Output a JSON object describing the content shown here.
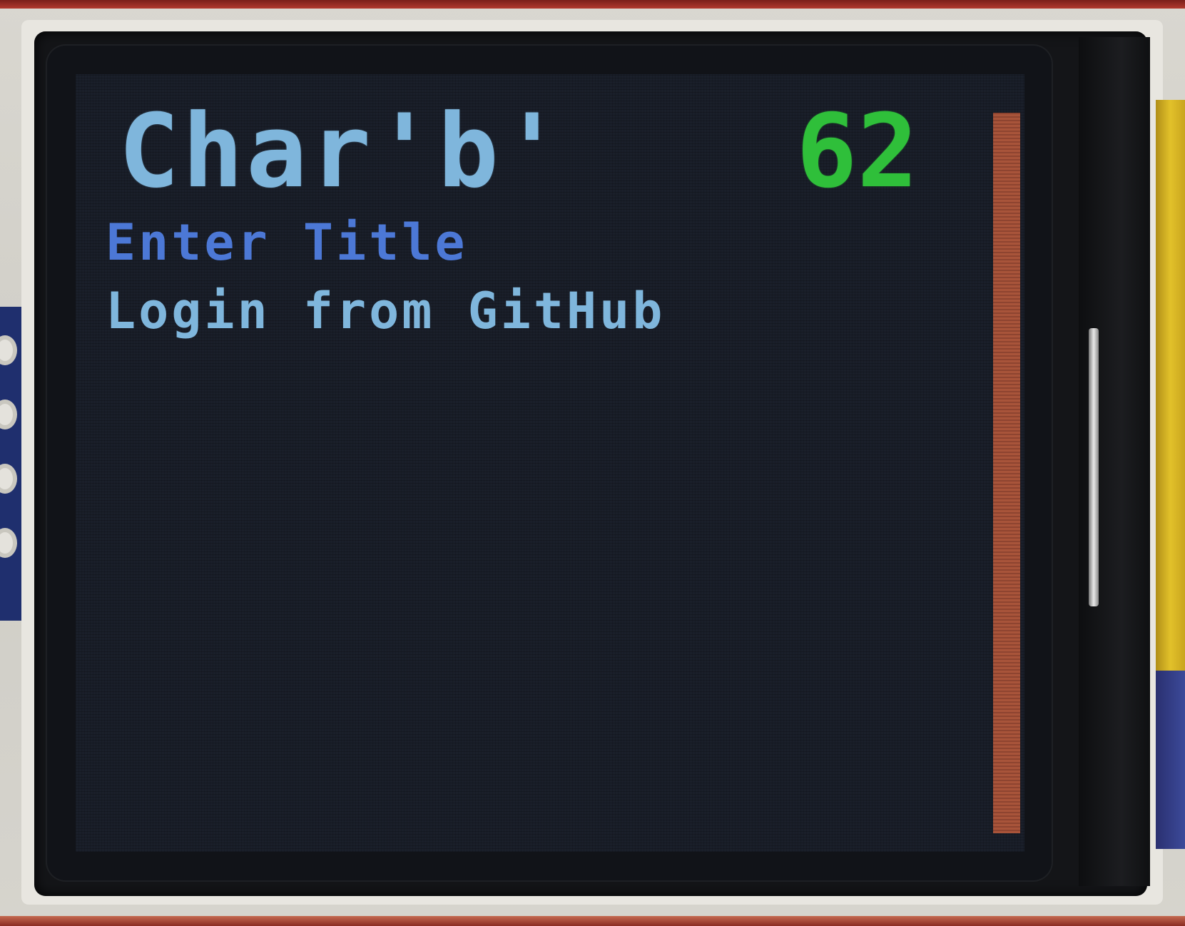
{
  "screen": {
    "title": "Char'b'",
    "counter": "62",
    "menu_items": [
      {
        "label": "Enter Title"
      },
      {
        "label": "Login from GitHub"
      }
    ]
  },
  "colors": {
    "title": "#7fb6dc",
    "counter": "#2fbf3a",
    "menu_item_selected": "#4c78d6",
    "menu_item": "#7fb6dc",
    "scrollbar": "#a8543a",
    "background": "#1a1f2a"
  }
}
